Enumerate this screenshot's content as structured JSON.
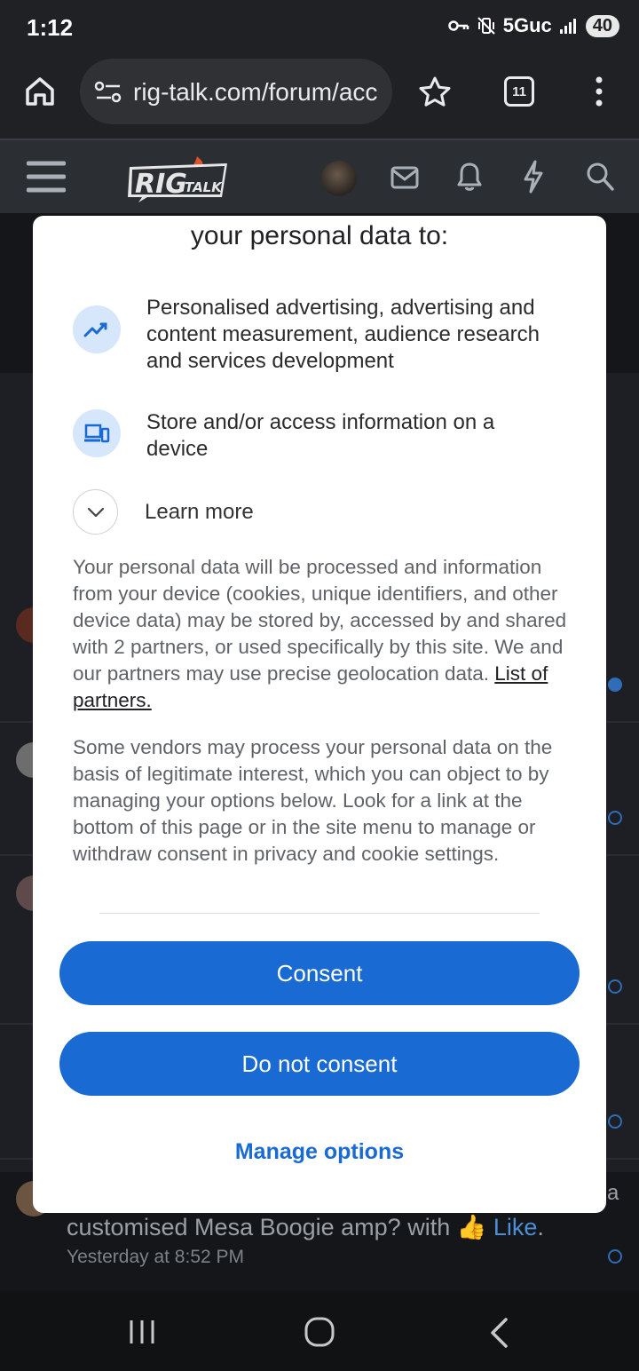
{
  "status_bar": {
    "time": "1:12",
    "network": "5Guc",
    "battery": "40"
  },
  "browser": {
    "url": "rig-talk.com/forum/acc",
    "tab_count": "11"
  },
  "site": {
    "logo_text": "RIG TALK"
  },
  "background": {
    "post_text": "customised Mesa Boogie amp? with",
    "like_label": "Like",
    "post_time": "Yesterday at 8:52 PM",
    "edge_letter": "a"
  },
  "dialog": {
    "heading": "your personal data to:",
    "purposes": [
      {
        "icon": "trend-chart-icon",
        "label": "Personalised advertising, advertising and content measurement, audience research and services development"
      },
      {
        "icon": "devices-icon",
        "label": "Store and/or access information on a device"
      }
    ],
    "learn_more": "Learn more",
    "paragraph_1": "Your personal data will be processed and information from your device (cookies, unique identifiers, and other device data) may be stored by, accessed by and shared with 2 partners, or used specifically by this site. We and our partners may use precise geolocation data.",
    "partners_link": "List of partners.",
    "paragraph_2": "Some vendors may process your personal data on the basis of legitimate interest, which you can object to by managing your options below. Look for a link at the bottom of this page or in the site menu to manage or withdraw consent in privacy and cookie settings.",
    "consent_button": "Consent",
    "do_not_consent_button": "Do not consent",
    "manage_options_button": "Manage options"
  },
  "colors": {
    "accent": "#1a6ad3",
    "icon_bg": "#d6e6fb"
  }
}
